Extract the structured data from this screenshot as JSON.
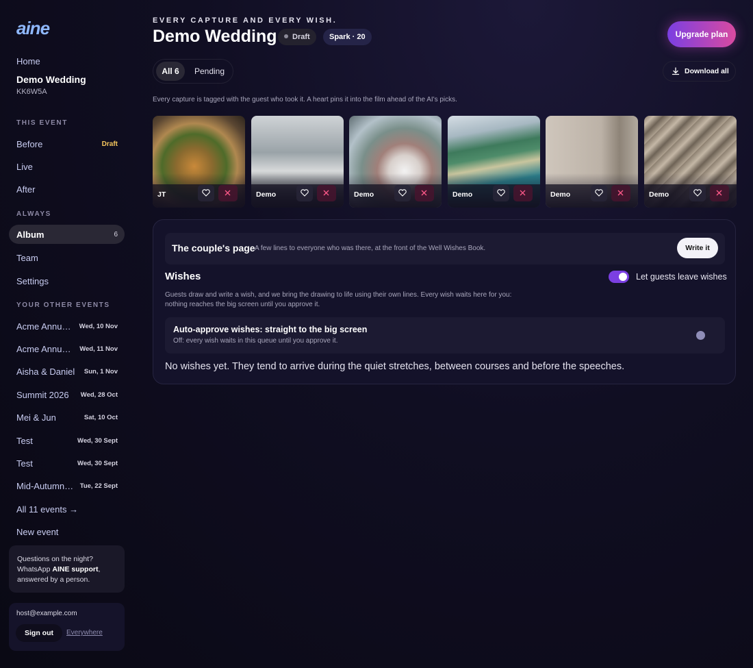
{
  "app": {
    "logo": "aine"
  },
  "sidebar": {
    "home": "Home",
    "current_event": {
      "name": "Demo Wedding",
      "code": "KK6W5A"
    },
    "this_event_label": "THIS EVENT",
    "phases": [
      {
        "label": "Before",
        "tag": "Draft"
      },
      {
        "label": "Live"
      },
      {
        "label": "After"
      }
    ],
    "always_label": "ALWAYS",
    "album": {
      "label": "Album",
      "count": "6"
    },
    "team": "Team",
    "settings": "Settings",
    "other_events_label": "YOUR OTHER EVENTS",
    "other_events": [
      {
        "name": "Acme Annual Dinner",
        "date": "Wed, 10 Nov"
      },
      {
        "name": "Acme Annual Dinner",
        "date": "Wed, 11 Nov"
      },
      {
        "name": "Aisha & Daniel",
        "date": "Sun, 1 Nov"
      },
      {
        "name": "Summit 2026",
        "date": "Wed, 28 Oct"
      },
      {
        "name": "Mei & Jun",
        "date": "Sat, 10 Oct"
      },
      {
        "name": "Test",
        "date": "Wed, 30 Sept"
      },
      {
        "name": "Test",
        "date": "Wed, 30 Sept"
      },
      {
        "name": "Mid-Autumn Festival",
        "date": "Tue, 22 Sept"
      }
    ],
    "all_events": "All 11 events →",
    "new_event": "New event",
    "support": {
      "line1": "Questions on the night?",
      "line2a": "WhatsApp ",
      "line2b": "AINE support",
      "line2c": ",",
      "line3": "answered by a person."
    },
    "account": {
      "email": "host@example.com",
      "sign_out": "Sign out",
      "everywhere": "Everywhere"
    }
  },
  "header": {
    "kicker": "EVERY CAPTURE AND EVERY WISH.",
    "title": "Demo Wedding",
    "status": "Draft",
    "spark": "Spark · 20",
    "upgrade": "Upgrade plan"
  },
  "filters": {
    "all": "All 6",
    "pending": "Pending",
    "download": "Download all"
  },
  "caption": "Every capture is tagged with the guest who took it. A heart pins it into the film ahead of the AI's picks.",
  "photos": [
    {
      "who": "JT",
      "subject": "burger"
    },
    {
      "who": "Demo",
      "subject": "hotel-room"
    },
    {
      "who": "Demo",
      "subject": "wedding-couple"
    },
    {
      "who": "Demo",
      "subject": "beach-bay"
    },
    {
      "who": "Demo",
      "subject": "wall-corner"
    },
    {
      "who": "Demo",
      "subject": "curtain-blinds"
    }
  ],
  "couples_page": {
    "title": "The couple's page",
    "subtitle": "A few lines to everyone who was there, at the front of the Well Wishes Book.",
    "button": "Write it"
  },
  "wishes": {
    "title": "Wishes",
    "toggle_label": "Let guests leave wishes",
    "toggle_on": true,
    "description": "Guests draw and write a wish, and we bring the drawing to life using their own lines. Every wish waits here for you: nothing reaches the big screen until you approve it.",
    "auto_title": "Auto-approve wishes: straight to the big screen",
    "auto_sub": "Off: every wish waits in this queue until you approve it.",
    "auto_on": false,
    "empty": "No wishes yet. They tend to arrive during the quiet stretches, between courses and before the speeches."
  },
  "colors": {
    "accent_start": "#7b3fe2",
    "accent_end": "#d94aa0",
    "draft_tag": "#f4c65d",
    "logo": "#8fb8ff"
  }
}
